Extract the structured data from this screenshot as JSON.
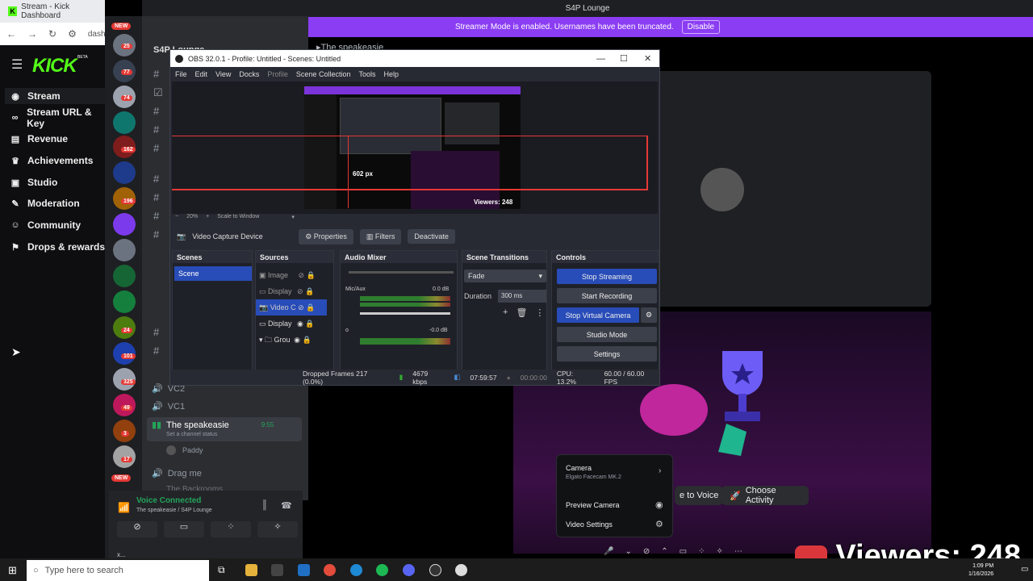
{
  "chrome": {
    "tab_title": "Stream - Kick Dashboard",
    "url": "dashb"
  },
  "kick": {
    "logo": "KICK",
    "logo_badge": "BETA",
    "nav": [
      "Stream",
      "Stream URL & Key",
      "Revenue",
      "Achievements",
      "Studio",
      "Moderation",
      "Community",
      "Drops & rewards"
    ]
  },
  "guilds": {
    "badges": [
      "25",
      "77",
      "74",
      "162",
      "196",
      "24",
      "101",
      "325",
      "49",
      "3",
      "17"
    ],
    "new_label": "NEW"
  },
  "discord": {
    "server_name": "S4P Lounge",
    "streamer_banner": "Streamer Mode is enabled. Usernames have been truncated.",
    "disable_button": "Disable",
    "top_channel": "The speakeasie",
    "channels": [
      "VC2",
      "VC1"
    ],
    "active_channel": "The speakeasie",
    "active_time": "9:55",
    "status_hint": "Set a channel status",
    "member": "Paddy",
    "drag_channel": "Drag me",
    "cut_channel": "The Backrooms",
    "voice_status": "Voice Connected",
    "voice_sub": "The speakeasie / S4P Lounge",
    "user_partial": "x..."
  },
  "obs": {
    "title": "OBS 32.0.1 - Profile: Untitled - Scenes: Untitled",
    "menu": [
      "File",
      "Edit",
      "View",
      "Docks",
      "Profile",
      "Scene Collection",
      "Tools",
      "Help"
    ],
    "preview_size_label": "602 px",
    "preview_viewers": "Viewers: 248",
    "zoom": "20%",
    "scale_mode": "Scale to Window",
    "source_name": "Video Capture Device",
    "properties": "Properties",
    "filters": "Filters",
    "deactivate": "Deactivate",
    "docks": {
      "scenes": {
        "title": "Scenes",
        "items": [
          "Scene"
        ]
      },
      "sources": {
        "title": "Sources",
        "items": [
          "Image",
          "Display",
          "Video C",
          "Display",
          "Grou"
        ]
      },
      "mixer": {
        "title": "Audio Mixer",
        "channels": [
          {
            "name": "Mic/Aux",
            "db": "0.0 dB"
          },
          {
            "name": "o",
            "db": "-0.0 dB"
          }
        ]
      },
      "transitions": {
        "title": "Scene Transitions",
        "type": "Fade",
        "duration_label": "Duration",
        "duration": "300 ms"
      },
      "controls": {
        "title": "Controls",
        "buttons": [
          "Stop Streaming",
          "Start Recording",
          "Stop Virtual Camera",
          "Studio Mode",
          "Settings"
        ]
      }
    },
    "status": {
      "dropped": "Dropped Frames 217 (0.0%)",
      "bitrate": "4679 kbps",
      "stream_time": "07:59:57",
      "rec_time": "00:00:00",
      "cpu": "CPU: 13.2%",
      "fps": "60.00 / 60.00 FPS"
    }
  },
  "call": {
    "camera_menu": {
      "camera_label": "Camera",
      "camera_device": "Elgato Facecam MK.2",
      "preview": "Preview Camera",
      "settings": "Video Settings"
    },
    "to_voice": "e to Voice",
    "choose_activity": "Choose Activity",
    "viewers_overlay": "Viewers: 248"
  },
  "taskbar": {
    "search_placeholder": "Type here to search",
    "time": "1:09 PM",
    "date": "1/16/2026"
  },
  "colors": {
    "kick_green": "#53fc18",
    "streamer_purple": "#8b3df3",
    "obs_blue": "#284cb8",
    "badge_red": "#e53935"
  }
}
